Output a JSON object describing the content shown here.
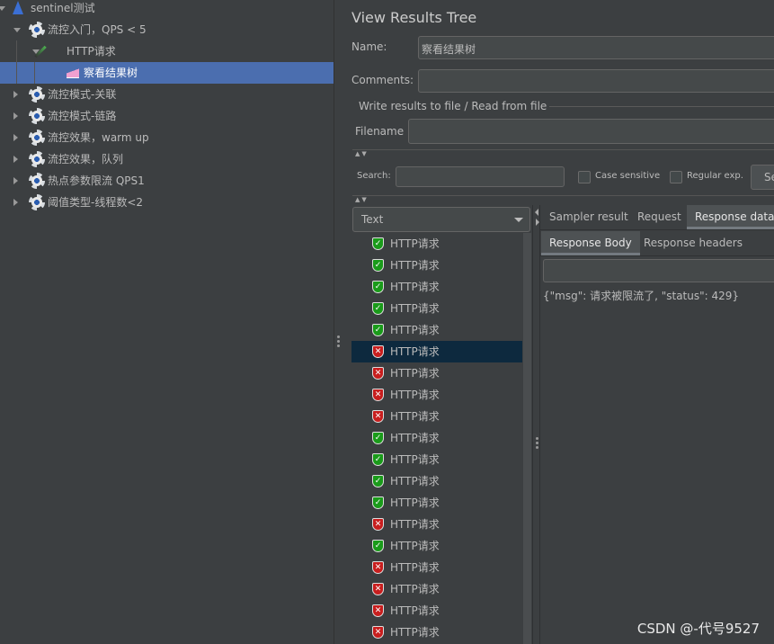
{
  "tree": {
    "items": [
      {
        "label": "sentinel测试",
        "icon": "test-plan-flask-icon",
        "level": 0,
        "expanded": true
      },
      {
        "label": "流控入门，QPS < 5",
        "icon": "gear-icon",
        "level": 1,
        "expanded": true
      },
      {
        "label": "HTTP请求",
        "icon": "pipette-icon",
        "level": 2,
        "expanded": true
      },
      {
        "label": "察看结果树",
        "icon": "listener-chart-icon",
        "level": 3,
        "selected": true
      },
      {
        "label": "流控模式-关联",
        "icon": "gear-icon",
        "level": 1
      },
      {
        "label": "流控模式-链路",
        "icon": "gear-icon",
        "level": 1
      },
      {
        "label": "流控效果，warm up",
        "icon": "gear-icon",
        "level": 1
      },
      {
        "label": "流控效果，队列",
        "icon": "gear-icon",
        "level": 1
      },
      {
        "label": "热点参数限流 QPS1",
        "icon": "gear-icon",
        "level": 1
      },
      {
        "label": "阈值类型-线程数<2",
        "icon": "gear-icon",
        "level": 1
      }
    ]
  },
  "panel": {
    "title": "View Results Tree",
    "name_label": "Name:",
    "name_value": "察看结果树",
    "comments_label": "Comments:",
    "comments_value": "",
    "file_group": "Write results to file / Read from file",
    "filename_label": "Filename",
    "filename_value": "",
    "search_label": "Search:",
    "search_value": "",
    "case_sensitive": "Case sensitive",
    "regular_exp": "Regular exp.",
    "search_button": "Se",
    "renderer": "Text"
  },
  "results": [
    {
      "label": "HTTP请求",
      "status": "ok"
    },
    {
      "label": "HTTP请求",
      "status": "ok"
    },
    {
      "label": "HTTP请求",
      "status": "ok"
    },
    {
      "label": "HTTP请求",
      "status": "ok"
    },
    {
      "label": "HTTP请求",
      "status": "ok"
    },
    {
      "label": "HTTP请求",
      "status": "error",
      "selected": true
    },
    {
      "label": "HTTP请求",
      "status": "error"
    },
    {
      "label": "HTTP请求",
      "status": "error"
    },
    {
      "label": "HTTP请求",
      "status": "error"
    },
    {
      "label": "HTTP请求",
      "status": "ok"
    },
    {
      "label": "HTTP请求",
      "status": "ok"
    },
    {
      "label": "HTTP请求",
      "status": "ok"
    },
    {
      "label": "HTTP请求",
      "status": "ok"
    },
    {
      "label": "HTTP请求",
      "status": "error"
    },
    {
      "label": "HTTP请求",
      "status": "ok"
    },
    {
      "label": "HTTP请求",
      "status": "error"
    },
    {
      "label": "HTTP请求",
      "status": "error"
    },
    {
      "label": "HTTP请求",
      "status": "error"
    },
    {
      "label": "HTTP请求",
      "status": "error"
    }
  ],
  "tabs": [
    "Sampler result",
    "Request",
    "Response data"
  ],
  "active_tab": "Response data",
  "subtabs": [
    "Response Body",
    "Response headers"
  ],
  "active_subtab": "Response Body",
  "response_body": "{\"msg\": 请求被限流了, \"status\": 429}",
  "watermark": "CSDN @-代号9527",
  "colors": {
    "background": "#3c3f41",
    "tree_selected": "#4b6eaf",
    "result_selected": "#0d293e",
    "ok": "#1a9b1a",
    "error": "#c81e1e"
  }
}
